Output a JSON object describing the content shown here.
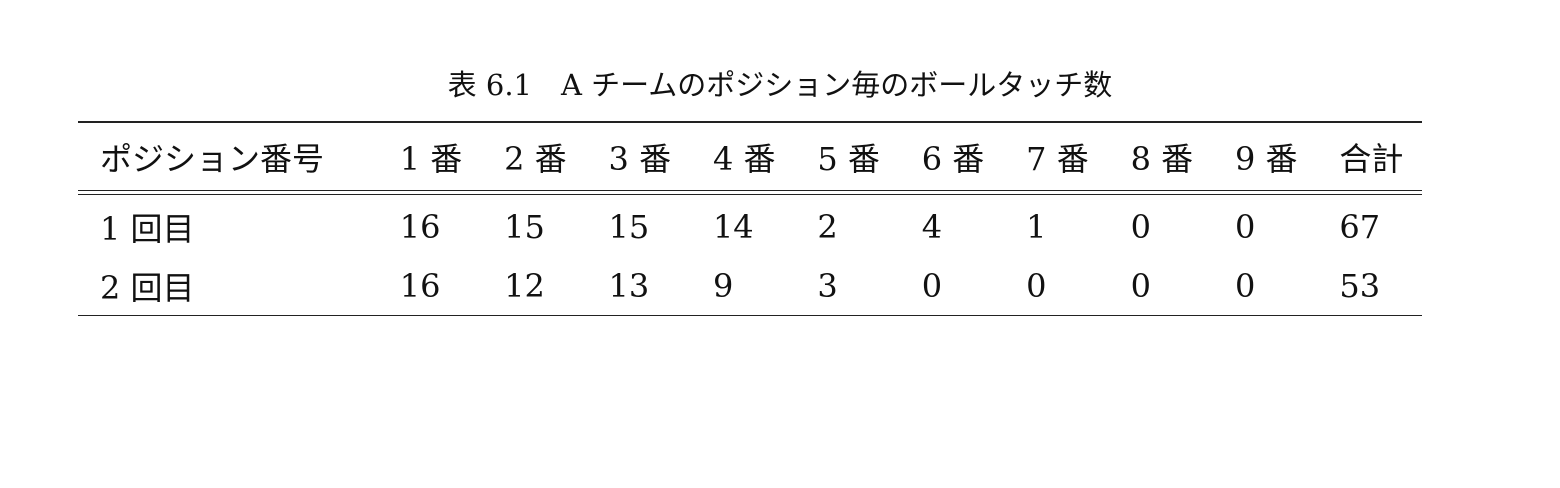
{
  "caption": "表 6.1　A チームのポジション毎のボールタッチ数",
  "table": {
    "header": [
      "ポジション番号",
      "1 番",
      "2 番",
      "3 番",
      "4 番",
      "5 番",
      "6 番",
      "7 番",
      "8 番",
      "9 番",
      "合計"
    ],
    "rows": [
      [
        "1 回目",
        "16",
        "15",
        "15",
        "14",
        "2",
        "4",
        "1",
        "0",
        "0",
        "67"
      ],
      [
        "2 回目",
        "16",
        "12",
        "13",
        "9",
        "3",
        "0",
        "0",
        "0",
        "0",
        "53"
      ]
    ]
  }
}
